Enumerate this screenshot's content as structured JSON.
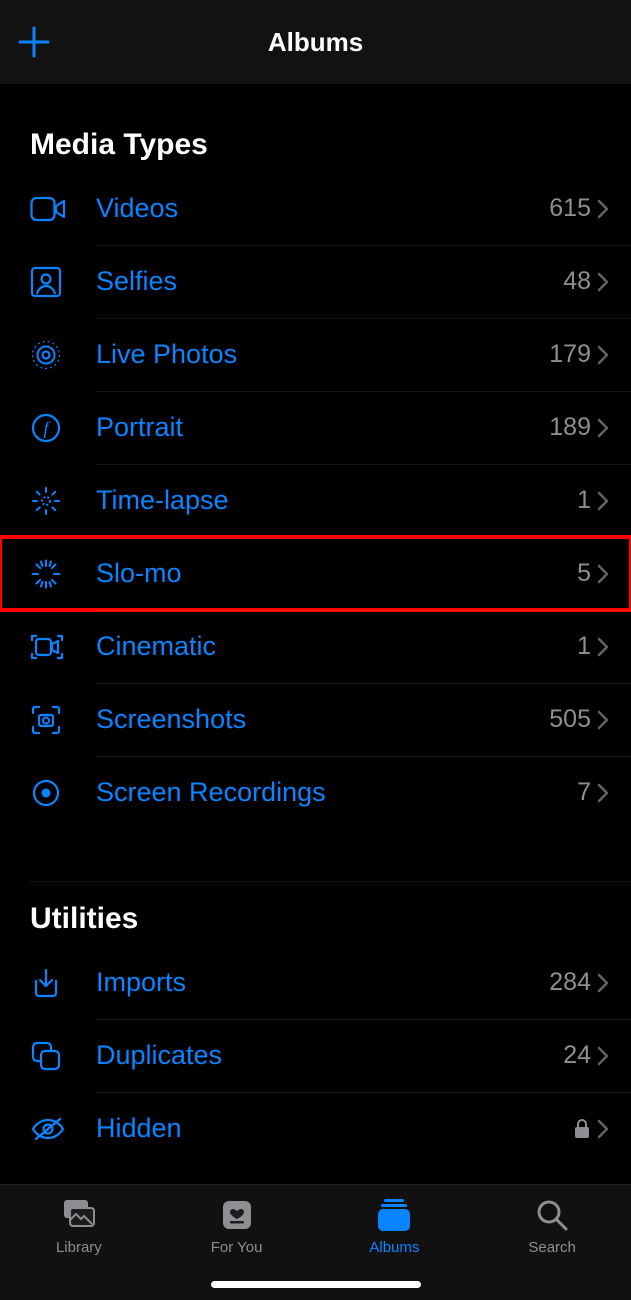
{
  "header": {
    "title": "Albums"
  },
  "sections": {
    "media_types": {
      "title": "Media Types",
      "items": [
        {
          "label": "Videos",
          "count": "615",
          "icon": "video-icon"
        },
        {
          "label": "Selfies",
          "count": "48",
          "icon": "selfies-icon"
        },
        {
          "label": "Live Photos",
          "count": "179",
          "icon": "live-photos-icon"
        },
        {
          "label": "Portrait",
          "count": "189",
          "icon": "portrait-icon"
        },
        {
          "label": "Time-lapse",
          "count": "1",
          "icon": "timelapse-icon"
        },
        {
          "label": "Slo-mo",
          "count": "5",
          "icon": "slomo-icon"
        },
        {
          "label": "Cinematic",
          "count": "1",
          "icon": "cinematic-icon"
        },
        {
          "label": "Screenshots",
          "count": "505",
          "icon": "screenshots-icon"
        },
        {
          "label": "Screen Recordings",
          "count": "7",
          "icon": "screen-recordings-icon"
        }
      ]
    },
    "utilities": {
      "title": "Utilities",
      "items": [
        {
          "label": "Imports",
          "count": "284",
          "icon": "imports-icon"
        },
        {
          "label": "Duplicates",
          "count": "24",
          "icon": "duplicates-icon"
        },
        {
          "label": "Hidden",
          "locked": true,
          "icon": "hidden-icon"
        }
      ]
    }
  },
  "tabbar": {
    "items": [
      {
        "label": "Library",
        "active": false
      },
      {
        "label": "For You",
        "active": false
      },
      {
        "label": "Albums",
        "active": true
      },
      {
        "label": "Search",
        "active": false
      }
    ]
  }
}
